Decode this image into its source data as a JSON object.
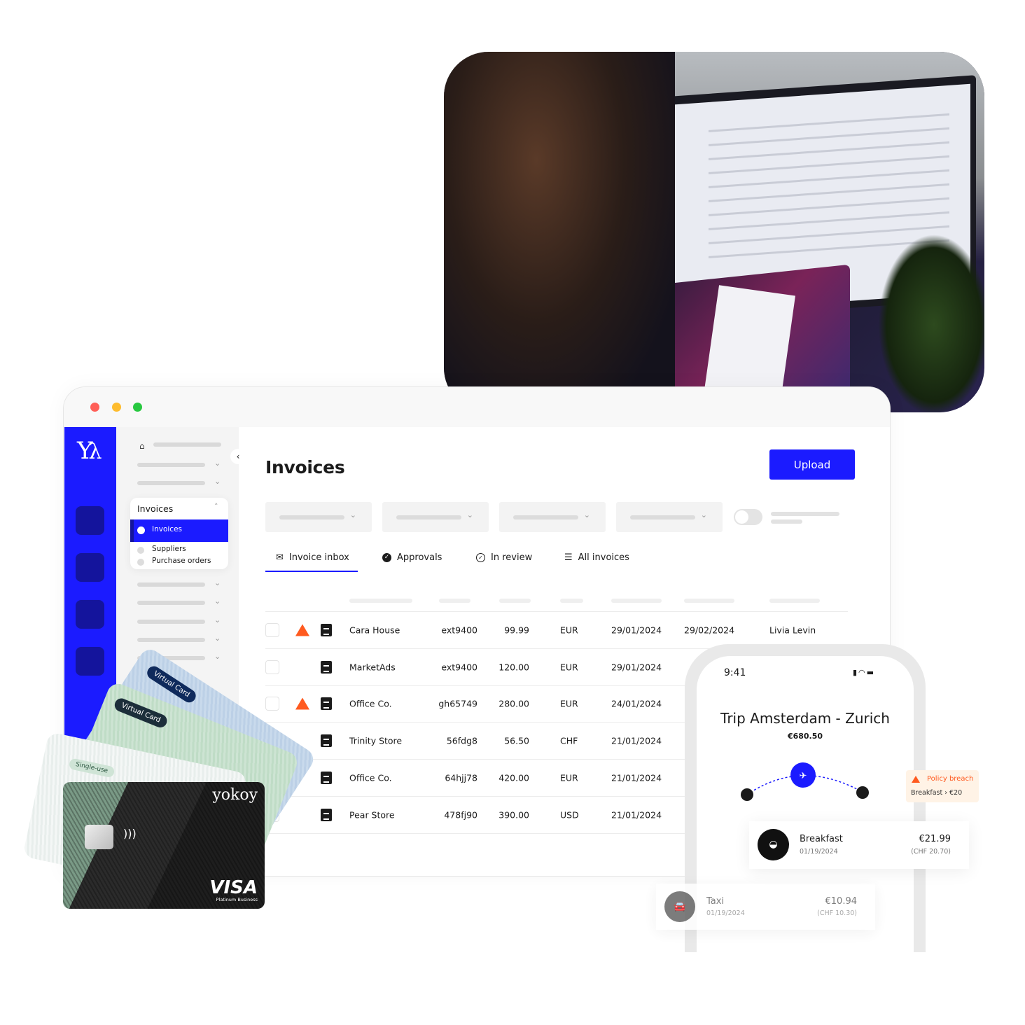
{
  "window_controls": {
    "close_color": "#ff5f57",
    "minimize_color": "#febc2e",
    "maximize_color": "#28c840"
  },
  "brand": {
    "logo": "yk",
    "accent": "#1b1bff"
  },
  "nav": {
    "dropdown": {
      "title": "Invoices",
      "items": [
        {
          "label": "Invoices",
          "active": true
        },
        {
          "label": "Suppliers",
          "active": false
        },
        {
          "label": "Purchase orders",
          "active": false
        }
      ]
    }
  },
  "main": {
    "title": "Invoices",
    "upload_label": "Upload",
    "tabs": [
      {
        "label": "Invoice inbox",
        "icon": "inbox-icon",
        "active": true
      },
      {
        "label": "Approvals",
        "icon": "check-circle-filled-icon",
        "active": false
      },
      {
        "label": "In review",
        "icon": "check-circle-outline-icon",
        "active": false
      },
      {
        "label": "All invoices",
        "icon": "list-icon",
        "active": false
      }
    ],
    "rows": [
      {
        "supplier": "Cara House",
        "ref": "ext9400",
        "amount": "99.99",
        "currency": "EUR",
        "date": "29/01/2024",
        "due": "29/02/2024",
        "owner": "Livia Levin",
        "warning": true
      },
      {
        "supplier": "MarketAds",
        "ref": "ext9400",
        "amount": "120.00",
        "currency": "EUR",
        "date": "29/01/2024",
        "warning": false
      },
      {
        "supplier": "Office Co.",
        "ref": "gh65749",
        "amount": "280.00",
        "currency": "EUR",
        "date": "24/01/2024",
        "warning": true
      },
      {
        "supplier": "Trinity Store",
        "ref": "56fdg8",
        "amount": "56.50",
        "currency": "CHF",
        "date": "21/01/2024",
        "warning": false
      },
      {
        "supplier": "Office Co.",
        "ref": "64hjj78",
        "amount": "420.00",
        "currency": "EUR",
        "date": "21/01/2024",
        "warning": false
      },
      {
        "supplier": "Pear Store",
        "ref": "478fj90",
        "amount": "390.00",
        "currency": "USD",
        "date": "21/01/2024",
        "warning": false
      }
    ]
  },
  "phone": {
    "time": "9:41",
    "trip_title": "Trip Amsterdam - Zurich",
    "trip_total": "€680.50",
    "policy": {
      "title": "Policy breach",
      "detail": "Breakfast › €20",
      "color": "#ff5a1f"
    },
    "expenses": [
      {
        "name": "Breakfast",
        "date": "01/19/2024",
        "amount": "€21.99",
        "converted": "(CHF 20.70)",
        "icon": "croissant-icon"
      },
      {
        "name": "Taxi",
        "date": "01/19/2024",
        "amount": "€10.94",
        "converted": "(CHF 10.30)",
        "icon": "car-icon"
      }
    ]
  },
  "cards": {
    "virtual_label": "Virtual Card",
    "single_use_label": "Single-use",
    "brand": "yokoy",
    "network": "VISA",
    "tier": "Platinum Business"
  }
}
